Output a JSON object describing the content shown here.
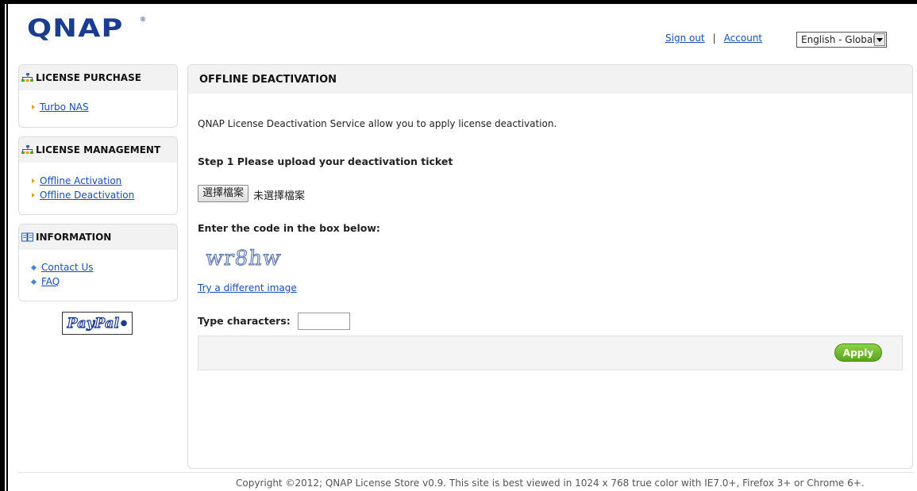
{
  "header": {
    "logo": "QNAP",
    "sign_out": "Sign out",
    "separator": "|",
    "account": "Account",
    "language": "English - Global"
  },
  "sidebar": {
    "sections": [
      {
        "title": "LICENSE PURCHASE",
        "icon": "sitemap-icon",
        "items": [
          {
            "label": "Turbo NAS"
          }
        ]
      },
      {
        "title": "LICENSE MANAGEMENT",
        "icon": "sitemap-icon",
        "items": [
          {
            "label": "Offline Activation"
          },
          {
            "label": "Offline Deactivation"
          }
        ]
      },
      {
        "title": "INFORMATION",
        "icon": "book-icon",
        "items": [
          {
            "label": "Contact Us"
          },
          {
            "label": "FAQ"
          }
        ]
      }
    ],
    "paypal": "PayPal"
  },
  "main": {
    "title": "OFFLINE DEACTIVATION",
    "intro": "QNAP License Deactivation Service allow you to apply license deactivation.",
    "step1": "Step 1 Please upload your deactivation ticket",
    "file_button": "選擇檔案",
    "file_status": "未選擇檔案",
    "enter_code": "Enter the code in the box below:",
    "captcha": "wr8hw",
    "try_different": "Try a different image",
    "type_label": "Type characters:",
    "type_value": "",
    "apply": "Apply"
  },
  "footer": {
    "text": "Copyright ©2012; QNAP License Store v0.9. This site is best viewed in 1024 x 768 true color with IE7.0+, Firefox 3+ or Chrome 6+."
  },
  "colors": {
    "link": "#1a4fb3",
    "brand": "#1b3d8f",
    "apply_green": "#6cb42a",
    "header_bg": "#f2f2f2"
  }
}
